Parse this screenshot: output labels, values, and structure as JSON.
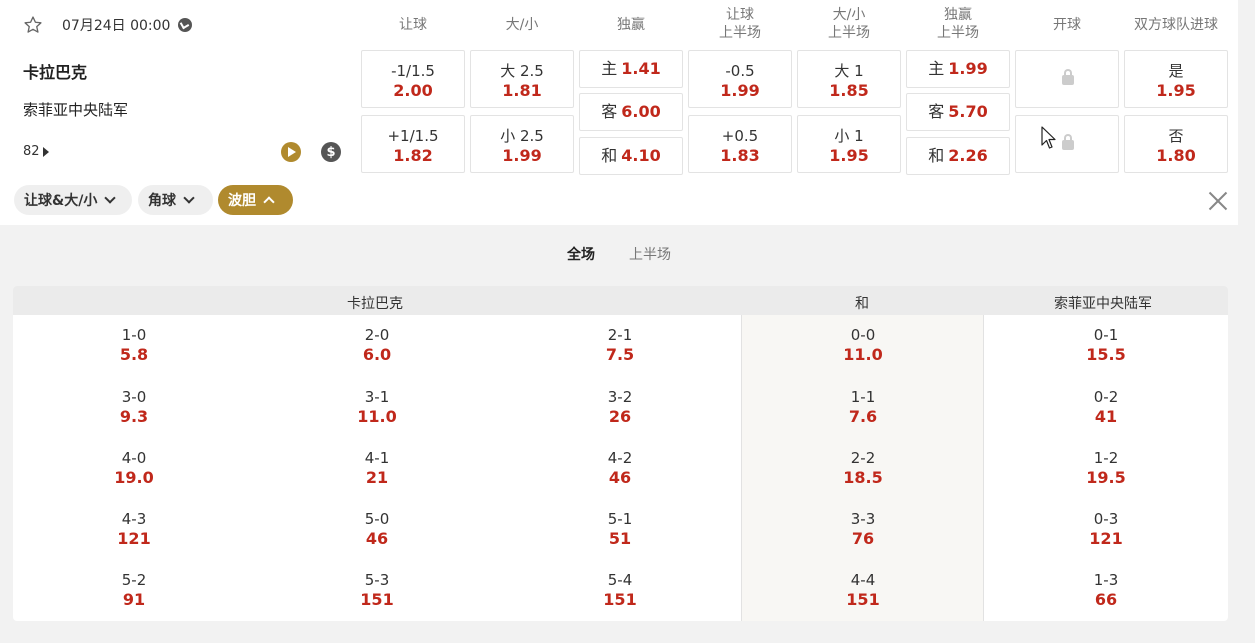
{
  "match": {
    "date": "07月24日 00:00",
    "home": "卡拉巴克",
    "away": "索菲亚中央陆军",
    "more_count": "82"
  },
  "columns": [
    {
      "line1": "让球",
      "line2": ""
    },
    {
      "line1": "大/小",
      "line2": ""
    },
    {
      "line1": "独赢",
      "line2": ""
    },
    {
      "line1": "让球",
      "line2": "上半场"
    },
    {
      "line1": "大/小",
      "line2": "上半场"
    },
    {
      "line1": "独赢",
      "line2": "上半场"
    },
    {
      "line1": "开球",
      "line2": ""
    },
    {
      "line1": "双方球队进球",
      "line2": ""
    }
  ],
  "odds": {
    "handicap": [
      {
        "label": "-1/1.5",
        "value": "2.00"
      },
      {
        "label": "+1/1.5",
        "value": "1.82"
      }
    ],
    "total": [
      {
        "label": "大 2.5",
        "value": "1.81"
      },
      {
        "label": "小 2.5",
        "value": "1.99"
      }
    ],
    "moneyline": [
      {
        "label": "主",
        "value": "1.41"
      },
      {
        "label": "客",
        "value": "6.00"
      },
      {
        "label": "和",
        "value": "4.10"
      }
    ],
    "handicap_1h": [
      {
        "label": "-0.5",
        "value": "1.99"
      },
      {
        "label": "+0.5",
        "value": "1.83"
      }
    ],
    "total_1h": [
      {
        "label": "大 1",
        "value": "1.85"
      },
      {
        "label": "小 1",
        "value": "1.95"
      }
    ],
    "moneyline_1h": [
      {
        "label": "主",
        "value": "1.99"
      },
      {
        "label": "客",
        "value": "5.70"
      },
      {
        "label": "和",
        "value": "2.26"
      }
    ],
    "btts": [
      {
        "label": "是",
        "value": "1.95"
      },
      {
        "label": "否",
        "value": "1.80"
      }
    ]
  },
  "filters": {
    "hdp_ou": "让球&大/小",
    "corners": "角球",
    "correct_score": "波胆"
  },
  "tabs": {
    "full": "全场",
    "first_half": "上半场"
  },
  "correct_score": {
    "header_home": "卡拉巴克",
    "header_draw": "和",
    "header_away": "索菲亚中央陆军",
    "home_col1": [
      {
        "s": "1-0",
        "o": "5.8"
      },
      {
        "s": "3-0",
        "o": "9.3"
      },
      {
        "s": "4-0",
        "o": "19.0"
      },
      {
        "s": "4-3",
        "o": "121"
      },
      {
        "s": "5-2",
        "o": "91"
      }
    ],
    "home_col2": [
      {
        "s": "2-0",
        "o": "6.0"
      },
      {
        "s": "3-1",
        "o": "11.0"
      },
      {
        "s": "4-1",
        "o": "21"
      },
      {
        "s": "5-0",
        "o": "46"
      },
      {
        "s": "5-3",
        "o": "151"
      }
    ],
    "home_col3": [
      {
        "s": "2-1",
        "o": "7.5"
      },
      {
        "s": "3-2",
        "o": "26"
      },
      {
        "s": "4-2",
        "o": "46"
      },
      {
        "s": "5-1",
        "o": "51"
      },
      {
        "s": "5-4",
        "o": "151"
      }
    ],
    "draw": [
      {
        "s": "0-0",
        "o": "11.0"
      },
      {
        "s": "1-1",
        "o": "7.6"
      },
      {
        "s": "2-2",
        "o": "18.5"
      },
      {
        "s": "3-3",
        "o": "76"
      },
      {
        "s": "4-4",
        "o": "151"
      }
    ],
    "away": [
      {
        "s": "0-1",
        "o": "15.5"
      },
      {
        "s": "0-2",
        "o": "41"
      },
      {
        "s": "1-2",
        "o": "19.5"
      },
      {
        "s": "0-3",
        "o": "121"
      },
      {
        "s": "1-3",
        "o": "66"
      }
    ]
  }
}
